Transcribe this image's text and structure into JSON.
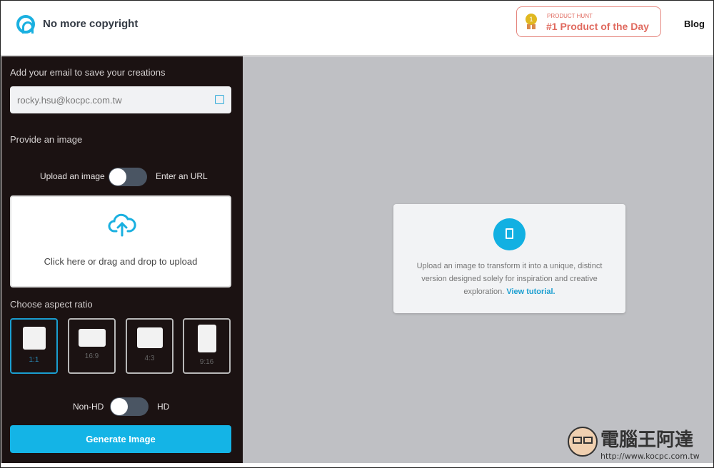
{
  "header": {
    "brand": "No more copyright",
    "product_hunt": {
      "small": "PRODUCT HUNT",
      "big": "#1 Product of the Day",
      "medal": "1"
    },
    "blog": "Blog"
  },
  "sidebar": {
    "email_label": "Add your email to save your creations",
    "email_value": "rocky.hsu@kocpc.com.tw",
    "image_label": "Provide an image",
    "source_toggle": {
      "left": "Upload an image",
      "right": "Enter an URL",
      "state": "upload"
    },
    "upload_text": "Click here or drag and drop to upload",
    "aspect_label": "Choose aspect ratio",
    "ratios": [
      {
        "label": "1:1",
        "selected": true
      },
      {
        "label": "16:9"
      },
      {
        "label": "4:3"
      },
      {
        "label": "9:16"
      }
    ],
    "hd_toggle": {
      "left": "Non-HD",
      "right": "HD",
      "state": "non-hd"
    },
    "generate": "Generate Image"
  },
  "main": {
    "card_text": "Upload an image to transform it into a unique, distinct version designed solely for inspiration and creative exploration.",
    "tutorial_link": "View tutorial."
  },
  "watermark": {
    "text": "電腦王阿達",
    "url": "http://www.kocpc.com.tw"
  },
  "colors": {
    "accent": "#14b4e6",
    "sidebar": "#1b1212",
    "main_bg": "#bfc0c4",
    "product_hunt": "#e06a5f"
  }
}
